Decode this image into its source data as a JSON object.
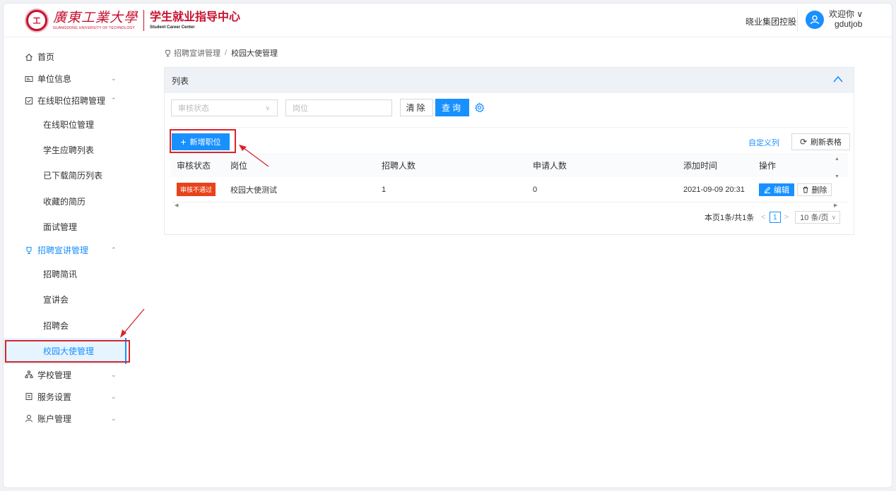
{
  "header": {
    "university_cn": "廣東工業大學",
    "university_en": "GUANGDONG UNIVERSITY OF TECHNOLOGY",
    "center_cn": "学生就业指导中心",
    "center_en": "Student Career Center",
    "company": "晓业集团控股",
    "greeting": "欢迎你 ∨",
    "username": "gdutjob"
  },
  "sidebar": {
    "home": "首页",
    "unit_info": "单位信息",
    "online_recruit": "在线职位招聘管理",
    "online_recruit_items": [
      "在线职位管理",
      "学生应聘列表",
      "已下载简历列表",
      "收藏的简历",
      "面试管理"
    ],
    "campus_talk": "招聘宣讲管理",
    "campus_talk_items": [
      "招聘简讯",
      "宣讲会",
      "招聘会",
      "校园大使管理"
    ],
    "school": "学校管理",
    "service": "服务设置",
    "account": "账户管理"
  },
  "breadcrumb": {
    "parent": "招聘宣讲管理",
    "separator": "/",
    "current": "校园大使管理"
  },
  "card": {
    "title": "列表",
    "filter": {
      "status_placeholder": "审核状态",
      "position_placeholder": "岗位",
      "clear_label": "清除",
      "query_label": "查询"
    },
    "add_label": "新增职位",
    "custom_columns": "自定义列",
    "refresh_label": "刷新表格"
  },
  "table": {
    "headers": {
      "status": "审核状态",
      "position": "岗位",
      "recruit_count": "招聘人数",
      "apply_count": "申请人数",
      "added_time": "添加时间",
      "actions": "操作"
    },
    "rows": [
      {
        "status": "审核不通过",
        "position": "校园大使测试",
        "recruit_count": "1",
        "apply_count": "0",
        "added_time": "2021-09-09 20:31",
        "edit": "编辑",
        "delete": "删除"
      }
    ]
  },
  "pager": {
    "summary": "本页1条/共1条",
    "prev": "<",
    "current_page": "1",
    "next": ">",
    "page_size": "10 条/页"
  },
  "colors": {
    "primary": "#1890ff",
    "brand": "#c8102e",
    "reject": "#e8421a",
    "highlight": "#d9232e"
  }
}
